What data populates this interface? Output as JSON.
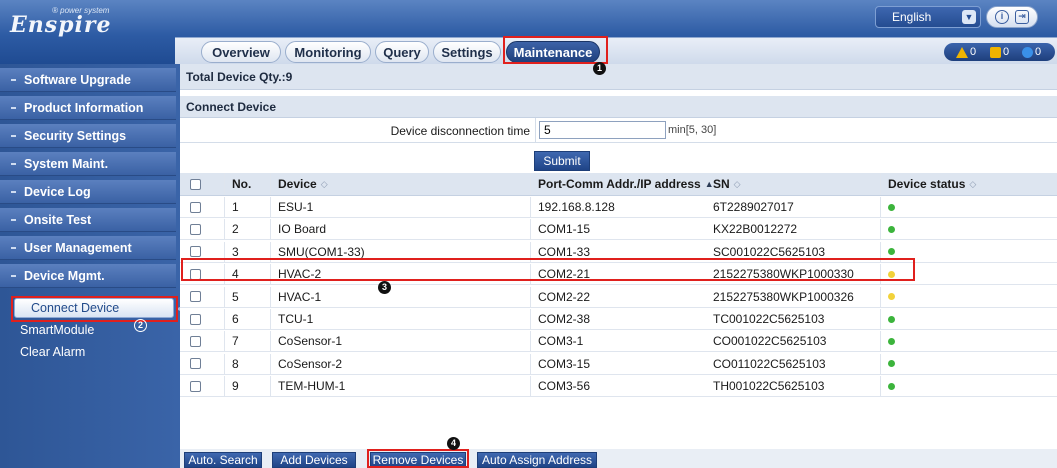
{
  "brand": {
    "name": "Enspire",
    "tagline": "power system"
  },
  "header": {
    "language": "English",
    "tabs": [
      {
        "label": "Overview"
      },
      {
        "label": "Monitoring"
      },
      {
        "label": "Query"
      },
      {
        "label": "Settings"
      },
      {
        "label": "Maintenance",
        "active": true
      }
    ],
    "alarms": {
      "major": "0",
      "minor": "0",
      "warning": "0"
    }
  },
  "sidebar": {
    "items": [
      {
        "label": "Software Upgrade"
      },
      {
        "label": "Product Information"
      },
      {
        "label": "Security Settings"
      },
      {
        "label": "System Maint."
      },
      {
        "label": "Device Log"
      },
      {
        "label": "Onsite Test"
      },
      {
        "label": "User Management"
      },
      {
        "label": "Device Mgmt."
      }
    ],
    "sub_items": [
      {
        "label": "Connect Device",
        "active": true
      },
      {
        "label": "SmartModule"
      },
      {
        "label": "Clear Alarm"
      }
    ]
  },
  "main": {
    "total_label": "Total Device Qty.:9",
    "section_title": "Connect Device",
    "form": {
      "label": "Device disconnection time",
      "value": "5",
      "range": "min[5, 30]",
      "submit": "Submit"
    },
    "table": {
      "columns": [
        "No.",
        "Device",
        "Port-Comm Addr./IP address",
        "SN",
        "Device status"
      ],
      "rows": [
        {
          "no": "1",
          "device": "ESU-1",
          "port": "192.168.8.128",
          "sn": "6T2289027017",
          "status": "green"
        },
        {
          "no": "2",
          "device": "IO Board",
          "port": "COM1-15",
          "sn": "KX22B0012272",
          "status": "green"
        },
        {
          "no": "3",
          "device": "SMU(COM1-33)",
          "port": "COM1-33",
          "sn": "SC001022C5625103",
          "status": "green"
        },
        {
          "no": "4",
          "device": "HVAC-2",
          "port": "COM2-21",
          "sn": "2152275380WKP1000330",
          "status": "yellow"
        },
        {
          "no": "5",
          "device": "HVAC-1",
          "port": "COM2-22",
          "sn": "2152275380WKP1000326",
          "status": "yellow"
        },
        {
          "no": "6",
          "device": "TCU-1",
          "port": "COM2-38",
          "sn": "TC001022C5625103",
          "status": "green"
        },
        {
          "no": "7",
          "device": "CoSensor-1",
          "port": "COM3-1",
          "sn": "CO001022C5625103",
          "status": "green"
        },
        {
          "no": "8",
          "device": "CoSensor-2",
          "port": "COM3-15",
          "sn": "CO011022C5625103",
          "status": "green"
        },
        {
          "no": "9",
          "device": "TEM-HUM-1",
          "port": "COM3-56",
          "sn": "TH001022C5625103",
          "status": "green"
        }
      ]
    },
    "buttons": [
      "Auto. Search",
      "Add Devices",
      "Remove Devices",
      "Auto Assign Address"
    ]
  },
  "callouts": [
    "1",
    "2",
    "3",
    "4"
  ],
  "colors": {
    "status_green": "#3cb43c",
    "status_yellow": "#f2d23a",
    "callout_red": "#e0201d",
    "header_blue": "#2d5ba4"
  }
}
